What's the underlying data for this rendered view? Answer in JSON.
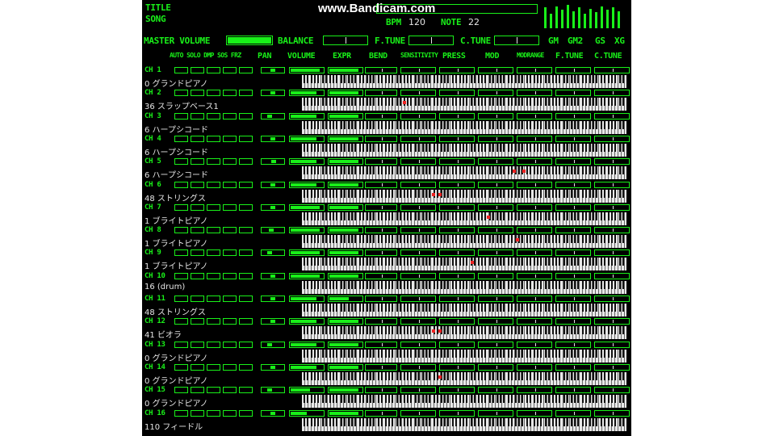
{
  "header": {
    "title_label": "TITLE",
    "song_label": "SONG",
    "watermark": "www.Bandicam.com",
    "bpm_label": "BPM",
    "bpm_value": "120",
    "note_label": "NOTE",
    "note_value": "22"
  },
  "controls": {
    "master_volume": "MASTER VOLUME",
    "master_volume_level": 1.0,
    "balance": "BALANCE",
    "f_tune": "F.TUNE",
    "c_tune": "C.TUNE",
    "modes": [
      "GM",
      "GM2",
      "GS",
      "XG"
    ]
  },
  "columns": {
    "fx_group": "AUTO SOLO DMP SOS FRZ",
    "pan": "PAN",
    "volume": "VOLUME",
    "expr": "EXPR",
    "bend": "BEND",
    "sensitivity": "SENSITIVITY",
    "press": "PRESS",
    "mod": "MOD",
    "modrange": "MODRANGE",
    "f_tune": "F.TUNE",
    "c_tune": "C.TUNE"
  },
  "channels": [
    {
      "ch": "CH 1",
      "instrument": "0 グランドピアノ",
      "pan": 0.5,
      "volume": 0.9,
      "expr": 0.9,
      "notes": []
    },
    {
      "ch": "CH 2",
      "instrument": "36 スラップベース1",
      "pan": 0.5,
      "volume": 0.8,
      "expr": 0.9,
      "notes": [
        0.31
      ]
    },
    {
      "ch": "CH 3",
      "instrument": "6 ハープシコード",
      "pan": 0.3,
      "volume": 0.8,
      "expr": 0.9,
      "notes": []
    },
    {
      "ch": "CH 4",
      "instrument": "6 ハープシコード",
      "pan": 0.5,
      "volume": 0.8,
      "expr": 0.9,
      "notes": []
    },
    {
      "ch": "CH 5",
      "instrument": "6 ハープシコード",
      "pan": 0.55,
      "volume": 0.8,
      "expr": 0.9,
      "notes": [
        0.65,
        0.68
      ]
    },
    {
      "ch": "CH 6",
      "instrument": "48 ストリングス",
      "pan": 0.5,
      "volume": 0.8,
      "expr": 0.9,
      "notes": [
        0.4,
        0.42
      ]
    },
    {
      "ch": "CH 7",
      "instrument": "1 ブライトピアノ",
      "pan": 0.5,
      "volume": 0.9,
      "expr": 0.9,
      "notes": [
        0.57
      ]
    },
    {
      "ch": "CH 8",
      "instrument": "1 ブライトピアノ",
      "pan": 0.4,
      "volume": 0.9,
      "expr": 0.9,
      "notes": [
        0.66
      ]
    },
    {
      "ch": "CH 9",
      "instrument": "1 ブライトピアノ",
      "pan": 0.3,
      "volume": 0.9,
      "expr": 0.9,
      "notes": [
        0.52
      ]
    },
    {
      "ch": "CH 10",
      "instrument": "16 (drum)",
      "pan": 0.5,
      "volume": 0.9,
      "expr": 0.9,
      "notes": []
    },
    {
      "ch": "CH 11",
      "instrument": "48 ストリングス",
      "pan": 0.5,
      "volume": 0.8,
      "expr": 0.6,
      "notes": []
    },
    {
      "ch": "CH 12",
      "instrument": "41 ビオラ",
      "pan": 0.5,
      "volume": 0.8,
      "expr": 0.9,
      "notes": [
        0.4,
        0.42
      ]
    },
    {
      "ch": "CH 13",
      "instrument": "0 グランドピアノ",
      "pan": 0.3,
      "volume": 0.8,
      "expr": 0.9,
      "notes": []
    },
    {
      "ch": "CH 14",
      "instrument": "0 グランドピアノ",
      "pan": 0.5,
      "volume": 0.8,
      "expr": 0.9,
      "notes": [
        0.42
      ]
    },
    {
      "ch": "CH 15",
      "instrument": "0 グランドピアノ",
      "pan": 0.3,
      "volume": 0.6,
      "expr": 0.9,
      "notes": []
    },
    {
      "ch": "CH 16",
      "instrument": "110 フィードル",
      "pan": 0.5,
      "volume": 0.5,
      "expr": 0.9,
      "notes": []
    }
  ],
  "level_meters": [
    0.85,
    0.6,
    0.9,
    0.75,
    0.95,
    0.7,
    0.85,
    0.6,
    0.8,
    0.65,
    0.9,
    0.75,
    0.85,
    0.7
  ],
  "colors": {
    "accent": "#19f019",
    "background": "#000000",
    "note": "#e22222",
    "frame": "#ffffff"
  }
}
